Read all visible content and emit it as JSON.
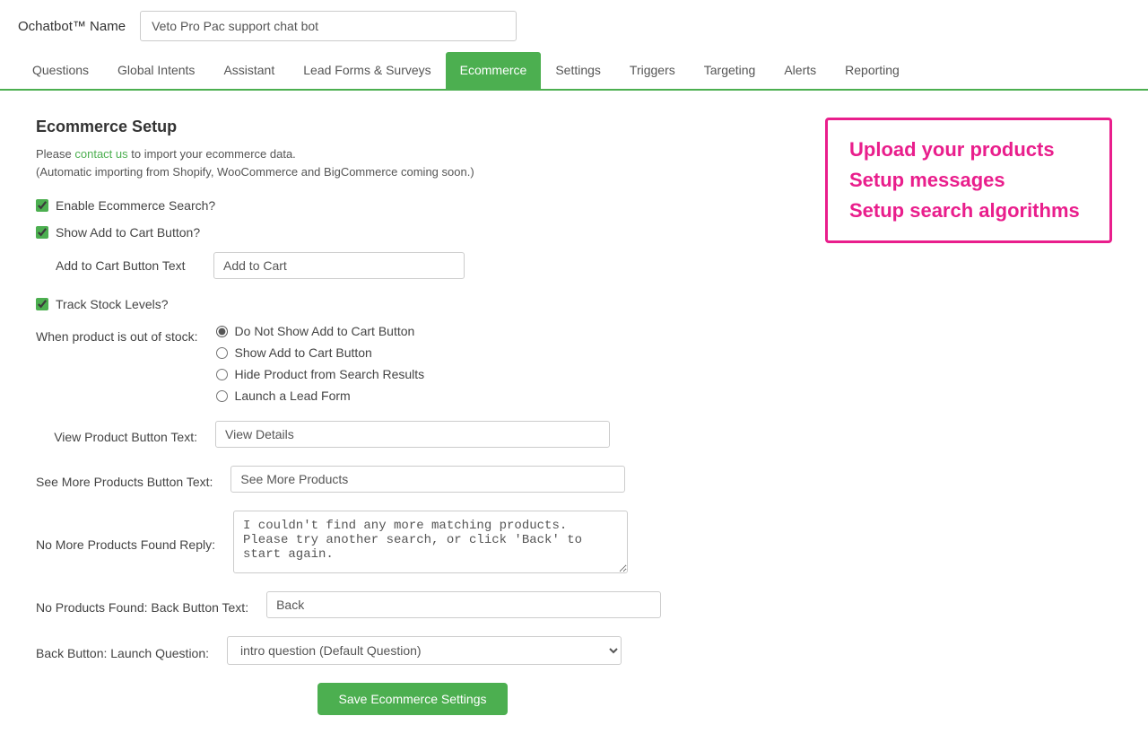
{
  "header": {
    "title": "Ochatbot™ Name",
    "bot_name": "Veto Pro Pac support chat bot"
  },
  "nav": {
    "items": [
      {
        "label": "Questions",
        "active": false
      },
      {
        "label": "Global Intents",
        "active": false
      },
      {
        "label": "Assistant",
        "active": false
      },
      {
        "label": "Lead Forms & Surveys",
        "active": false
      },
      {
        "label": "Ecommerce",
        "active": true
      },
      {
        "label": "Settings",
        "active": false
      },
      {
        "label": "Triggers",
        "active": false
      },
      {
        "label": "Targeting",
        "active": false
      },
      {
        "label": "Alerts",
        "active": false
      },
      {
        "label": "Reporting",
        "active": false
      }
    ]
  },
  "page": {
    "title": "Ecommerce Setup",
    "desc_prefix": "Please",
    "desc_link": "contact us",
    "desc_suffix": "to import your ecommerce data.",
    "desc_note": "(Automatic importing from Shopify, WooCommerce and BigCommerce coming soon.)"
  },
  "promo": {
    "line1": "Upload your products",
    "line2": "Setup messages",
    "line3": "Setup search algorithms"
  },
  "form": {
    "enable_ecommerce_label": "Enable Ecommerce Search?",
    "show_add_to_cart_label": "Show Add to Cart Button?",
    "add_to_cart_button_text_label": "Add to Cart Button Text",
    "add_to_cart_button_text_value": "Add to Cart",
    "track_stock_label": "Track Stock Levels?",
    "out_of_stock_label": "When product is out of stock:",
    "out_of_stock_options": [
      {
        "label": "Do Not Show Add to Cart Button",
        "checked": true
      },
      {
        "label": "Show Add to Cart Button",
        "checked": false
      },
      {
        "label": "Hide Product from Search Results",
        "checked": false
      },
      {
        "label": "Launch a Lead Form",
        "checked": false
      }
    ],
    "view_product_label": "View Product Button Text:",
    "view_product_value": "View Details",
    "see_more_label": "See More Products Button Text:",
    "see_more_value": "See More Products",
    "no_more_label": "No More Products Found Reply:",
    "no_more_value": "I couldn't find any more matching products.  Please try another search, or click 'Back' to start again.",
    "no_products_label": "No Products Found: Back Button Text:",
    "no_products_value": "Back",
    "back_button_label": "Back Button: Launch Question:",
    "back_button_value": "intro question (Default Question)",
    "back_button_options": [
      "intro question (Default Question)"
    ],
    "save_button_label": "Save Ecommerce Settings"
  }
}
